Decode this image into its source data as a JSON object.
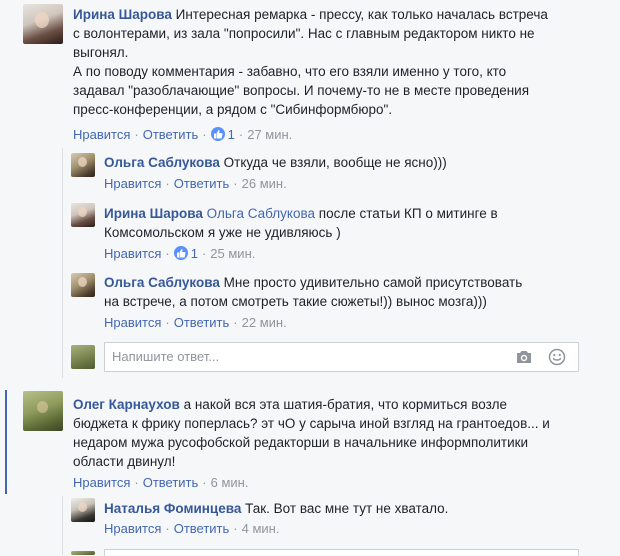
{
  "comments": [
    {
      "author": "Ирина Шарова",
      "lines": [
        "Интересная ремарка - прессу, как только началась встреча",
        "с волонтерами, из зала \"попросили\". Нас с главным редактором никто не",
        "выгонял.",
        "А по поводу комментария - забавно, что его взяли именно у того, кто",
        "задавал \"разоблачающие\" вопросы. И почему-то не в месте проведения",
        "пресс-конференции, а рядом с \"Сибинформбюро\"."
      ],
      "like": "Нравится",
      "reply": "Ответить",
      "reactions": "1",
      "time": "27 мин."
    },
    {
      "author": "Ольга Саблукова",
      "lines": [
        "Откуда че взяли, вообще не ясно)))"
      ],
      "like": "Нравится",
      "reply": "Ответить",
      "time": "26 мин."
    },
    {
      "author": "Ирина Шарова",
      "mention": "Ольга Саблукова",
      "lines": [
        "после статьи КП о митинге в",
        "Комсомольском я уже не удивляюсь )"
      ],
      "like": "Нравится",
      "reply": "Ответить",
      "reactions": "1",
      "time": "25 мин."
    },
    {
      "author": "Ольга Саблукова",
      "lines": [
        "Мне просто удивительно самой присутствовать",
        "на встрече, а потом смотреть такие сюжеты!)) вынос мозга)))"
      ],
      "like": "Нравится",
      "reply": "Ответить",
      "time": "22 мин."
    },
    {
      "author": "Олег Карнаухов",
      "lines": [
        "а накой вся эта шатия-братия, что кормиться возле",
        "бюджета к фрику поперлась? эт чО у сарыча иной взгляд на грантоедов... и",
        "недаром мужа русофобской редакторши в начальнике информполитики",
        "области двинул!"
      ],
      "like": "Нравится",
      "reply": "Ответить",
      "time": "6 мин."
    },
    {
      "author": "Наталья Фоминцева",
      "lines": [
        "Так. Вот вас мне тут не хватало."
      ],
      "like": "Нравится",
      "reply": "Ответить",
      "time": "4 мин."
    }
  ],
  "reply_box": {
    "placeholder": "Напишите ответ..."
  },
  "icons": {
    "camera": "camera-icon",
    "emoji": "emoji-icon",
    "reaction": "like-reaction-icon"
  },
  "colors": {
    "author": "#365899",
    "link": "#4267b2",
    "meta": "#90949c",
    "reaction": "#5890ff"
  }
}
